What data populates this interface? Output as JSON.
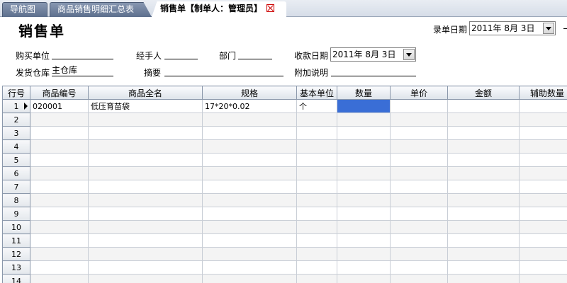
{
  "tabs": [
    {
      "label": "导航图"
    },
    {
      "label": "商品销售明细汇总表"
    },
    {
      "label": "销售单【制单人：管理员】"
    }
  ],
  "header": {
    "title": "销售单",
    "entry_date_label": "录单日期",
    "entry_date_value": "2011年 8月 3日"
  },
  "form": {
    "buyer_label": "购买单位",
    "buyer_value": "",
    "handler_label": "经手人",
    "handler_value": "",
    "dept_label": "部门",
    "dept_value": "",
    "pay_date_label": "收款日期",
    "pay_date_value": "2011年 8月 3日",
    "warehouse_label": "发货仓库",
    "warehouse_value": "主仓库",
    "summary_label": "摘要",
    "summary_value": "",
    "note_label": "附加说明",
    "note_value": ""
  },
  "grid": {
    "columns": [
      "行号",
      "商品编号",
      "商品全名",
      "规格",
      "基本单位",
      "数量",
      "单价",
      "金额",
      "辅助数量"
    ],
    "rows": [
      {
        "no": "1",
        "code": "020001",
        "name": "低压育苗袋",
        "spec": "17*20*0.02",
        "unit": "个"
      },
      {
        "no": "2"
      },
      {
        "no": "3"
      },
      {
        "no": "4"
      },
      {
        "no": "5"
      },
      {
        "no": "6"
      },
      {
        "no": "7"
      },
      {
        "no": "8"
      },
      {
        "no": "9"
      },
      {
        "no": "10"
      },
      {
        "no": "11"
      },
      {
        "no": "12"
      },
      {
        "no": "13"
      },
      {
        "no": "14"
      }
    ]
  },
  "colors": {
    "selection": "#3a6ed6",
    "tab_inactive": "#6f809c"
  }
}
